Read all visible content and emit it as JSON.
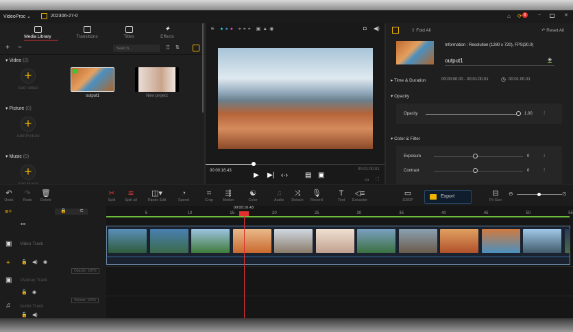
{
  "app": {
    "name": "VideoProc",
    "project": "202306-27-0",
    "notification_count": "6"
  },
  "library": {
    "tabs": [
      {
        "label": "Media Library"
      },
      {
        "label": "Transitions"
      },
      {
        "label": "Titles"
      },
      {
        "label": "Effects"
      }
    ],
    "search_placeholder": "Search...",
    "sections": [
      {
        "name": "Video",
        "count": "(2)",
        "add": "Add Video"
      },
      {
        "name": "Picture",
        "count": "(0)",
        "add": "Add Picture"
      },
      {
        "name": "Music",
        "count": "(0)",
        "add": "Add Music"
      }
    ],
    "items": [
      {
        "label": "output1"
      },
      {
        "label": "New project"
      }
    ]
  },
  "preview": {
    "current_time": "00:00:16.43",
    "total_time": "00:01:00.01",
    "progress": 0.27
  },
  "inspector": {
    "fold_all": "Fold All",
    "reset_all": "Reset All",
    "info": "Information : Resolution (1280 x 720), FPS(30.0)",
    "clip_name": "output1",
    "time_section": "Time & Duration",
    "time_range": "00:00:00.00 - 00:01:00.01",
    "duration": "00:01:00.01",
    "opacity_section": "Opacity",
    "opacity_label": "Opacity",
    "opacity_value": "1.00",
    "color_section": "Color & Filter",
    "exposure_label": "Exposure",
    "exposure_value": "0",
    "contrast_label": "Contrast",
    "contrast_value": "0"
  },
  "toolbar": {
    "undo": "Undo",
    "redo": "Redo",
    "delete": "Delete",
    "split": "Split",
    "split_all": "Split all",
    "ripple_edit": "Ripple Edit",
    "speed": "Speed",
    "crop": "Crop",
    "motion": "Motion",
    "color": "Color",
    "audio": "Audio",
    "detach": "Detach",
    "record": "Record",
    "text": "Text",
    "extractor": "Extractor",
    "resolution": "1080P",
    "export": "Export",
    "fit_size": "Fit Size"
  },
  "timeline": {
    "playhead": "00:00:16.43",
    "playhead_seconds": 16.43,
    "ticks": [
      "5",
      "10",
      "15",
      "20",
      "25",
      "30",
      "35",
      "40",
      "45",
      "50",
      "55"
    ],
    "tracks": [
      {
        "name": "Video Track"
      },
      {
        "name": "Overlay Track",
        "badge": "Opacity: 100%"
      },
      {
        "name": "Audio Track",
        "badge": "Volume: 100%"
      }
    ]
  },
  "colors": {
    "accent": "#f0b400",
    "split": "#e23a3a",
    "ruler": "#6dbb3a",
    "playhead": "#e03030"
  }
}
